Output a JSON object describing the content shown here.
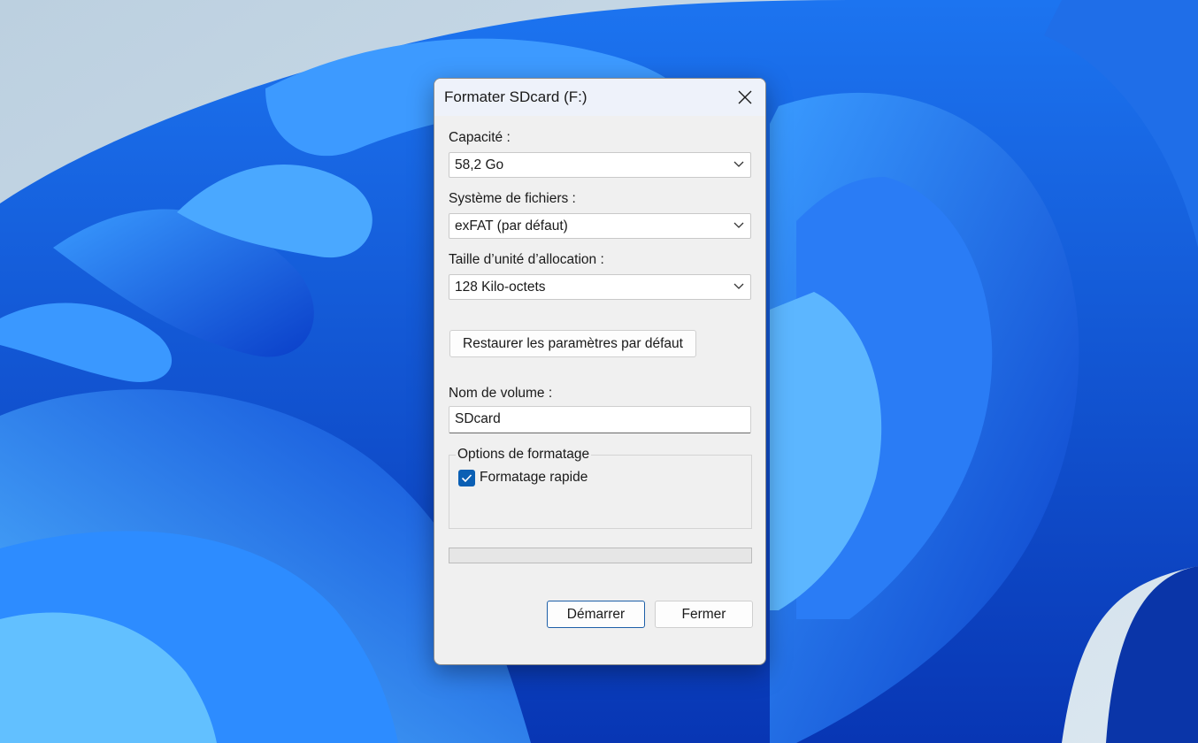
{
  "dialog": {
    "title": "Formater SDcard (F:)",
    "capacity": {
      "label": "Capacité :",
      "value": "58,2 Go"
    },
    "file_system": {
      "label": "Système de fichiers :",
      "value": "exFAT (par défaut)"
    },
    "allocation": {
      "label": "Taille d’unité d’allocation :",
      "value": "128 Kilo-octets"
    },
    "restore_label": "Restaurer les paramètres par défaut",
    "volume": {
      "label": "Nom de volume :",
      "value": "SDcard"
    },
    "options": {
      "legend": "Options de formatage",
      "quick_format_label": "Formatage rapide",
      "quick_format_checked": true
    },
    "progress": 0,
    "start_label": "Démarrer",
    "close_label": "Fermer"
  },
  "icons": {
    "close": "close-icon",
    "dropdown": "chevron-down-icon",
    "check": "checkmark-icon"
  },
  "colors": {
    "accent": "#0a5fb4",
    "wallpaper_blue": "#1565e8",
    "wallpaper_sky": "#c6d8e8"
  }
}
